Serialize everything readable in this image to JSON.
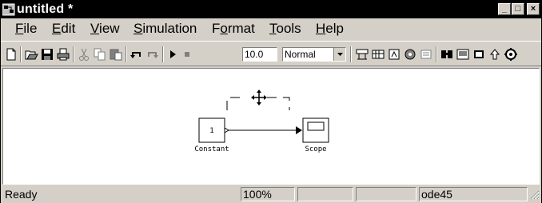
{
  "window": {
    "title": "untitled *",
    "buttons": {
      "minimize": "_",
      "maximize": "□",
      "close": "×"
    }
  },
  "menu": [
    {
      "first": "F",
      "rest": "ile"
    },
    {
      "first": "E",
      "rest": "dit"
    },
    {
      "first": "V",
      "rest": "iew"
    },
    {
      "first": "S",
      "rest": "imulation"
    },
    {
      "pre": "F",
      "first": "o",
      "rest": "rmat"
    },
    {
      "first": "T",
      "rest": "ools"
    },
    {
      "first": "H",
      "rest": "elp"
    }
  ],
  "toolbar": {
    "stop_time": "10.0",
    "sim_mode": "Normal",
    "icons": [
      "new-file-icon",
      "open-folder-icon",
      "save-icon",
      "print-icon",
      "cut-icon",
      "copy-icon",
      "paste-icon",
      "undo-icon",
      "redo-icon",
      "run-icon",
      "stop-icon",
      "build-icon",
      "update-diagram-icon",
      "model-explorer-icon",
      "library-browser-icon",
      "debugger-icon",
      "model-browser-icon",
      "toggle-view-icon",
      "navigate-up-icon",
      "settings-icon"
    ]
  },
  "diagram": {
    "constant_value": "1",
    "constant_label": "Constant",
    "scope_label": "Scope"
  },
  "status": {
    "state": "Ready",
    "zoom": "100%",
    "cell3": "",
    "cell4": "",
    "solver": "ode45"
  }
}
